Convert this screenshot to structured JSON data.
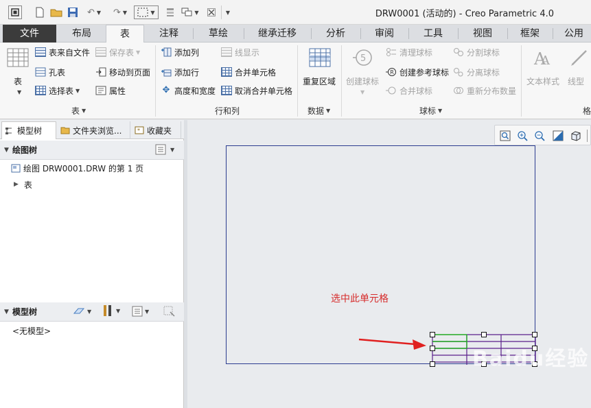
{
  "window": {
    "title": "DRW0001 (活动的) - Creo Parametric 4.0"
  },
  "tabs": [
    {
      "label": "文件"
    },
    {
      "label": "布局"
    },
    {
      "label": "表"
    },
    {
      "label": "注释"
    },
    {
      "label": "草绘"
    },
    {
      "label": "继承迁移"
    },
    {
      "label": "分析"
    },
    {
      "label": "审阅"
    },
    {
      "label": "工具"
    },
    {
      "label": "视图"
    },
    {
      "label": "框架"
    },
    {
      "label": "公用"
    }
  ],
  "ribbon": {
    "table_group": {
      "label": "表",
      "big_table": "表",
      "from_file": "表来自文件",
      "save_table": "保存表",
      "hole_table": "孔表",
      "move_to_page": "移动到页面",
      "select_table": "选择表",
      "properties": "属性"
    },
    "rows_cols_group": {
      "label": "行和列",
      "add_column": "添加列",
      "line_display": "线显示",
      "add_row": "添加行",
      "merge_cells": "合并单元格",
      "height_width": "高度和宽度",
      "unmerge_cells": "取消合并单元格"
    },
    "data_group": {
      "label": "数据",
      "repeat_region": "重复区域"
    },
    "balloon_group": {
      "label": "球标",
      "create_balloon": "创建球标",
      "clean_balloons": "清理球标",
      "create_ref_balloon": "创建参考球标",
      "merge_balloons": "合并球标",
      "split_balloon": "分割球标",
      "detach_balloon": "分离球标",
      "redistribute_qty": "重新分布数量"
    },
    "format_group": {
      "label": "格",
      "text_style": "文本样式",
      "line_style": "线型"
    }
  },
  "left_panel": {
    "tabs": [
      "模型树",
      "文件夹浏览...",
      "收藏夹"
    ],
    "drawing_tree": {
      "header": "绘图树",
      "items": [
        "绘图 DRW0001.DRW 的第 1 页",
        "表"
      ]
    },
    "model_tree": {
      "header": "模型树",
      "empty": "<无模型>"
    }
  },
  "canvas": {
    "annotation": "选中此单元格",
    "watermark": "Baidu经验",
    "colors": {
      "sheet_border": "#2a3b8f",
      "table_lines": "#5a1f8a",
      "selected_cell": "#22aa22",
      "arrow": "#e02020",
      "annotation": "#d62b2b"
    }
  }
}
